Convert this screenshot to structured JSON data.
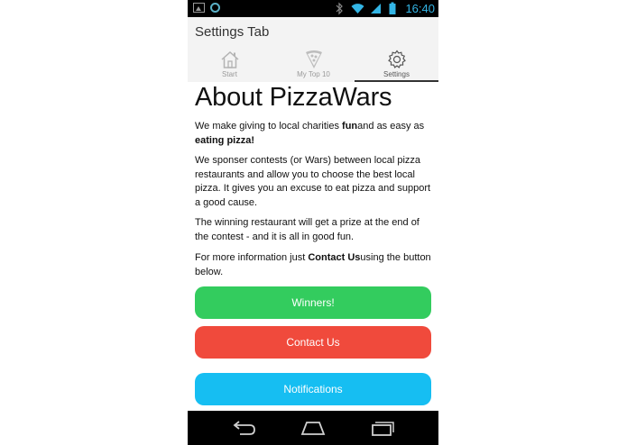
{
  "status_bar": {
    "time": "16:40"
  },
  "app_bar": {
    "title": "Settings Tab"
  },
  "tabs": [
    {
      "label": "Start",
      "icon": "home-icon",
      "active": false
    },
    {
      "label": "My Top 10",
      "icon": "pizza-slice-icon",
      "active": false
    },
    {
      "label": "Settings",
      "icon": "gear-icon",
      "active": true
    }
  ],
  "content": {
    "heading": "About PizzaWars",
    "p1_a": "We make giving to local charities ",
    "p1_b": "fun",
    "p1_c": "and as easy as ",
    "p1_d": "eating pizza!",
    "p2": "We sponser contests (or Wars) between local pizza restaurants and allow you to choose the best local pizza. It gives you an excuse to eat pizza and support a good cause.",
    "p3": "The winning restaurant will get a prize at the end of the contest - and it is all in good fun.",
    "p4_a": "For more information just ",
    "p4_b": "Contact Us",
    "p4_c": "using the button below."
  },
  "buttons": {
    "winners": "Winners!",
    "contact": "Contact Us",
    "notifications": "Notifications"
  },
  "colors": {
    "winners": "#33cc5e",
    "contact": "#f04a3c",
    "notifications": "#16bef2",
    "status_accent": "#33b5e5"
  }
}
